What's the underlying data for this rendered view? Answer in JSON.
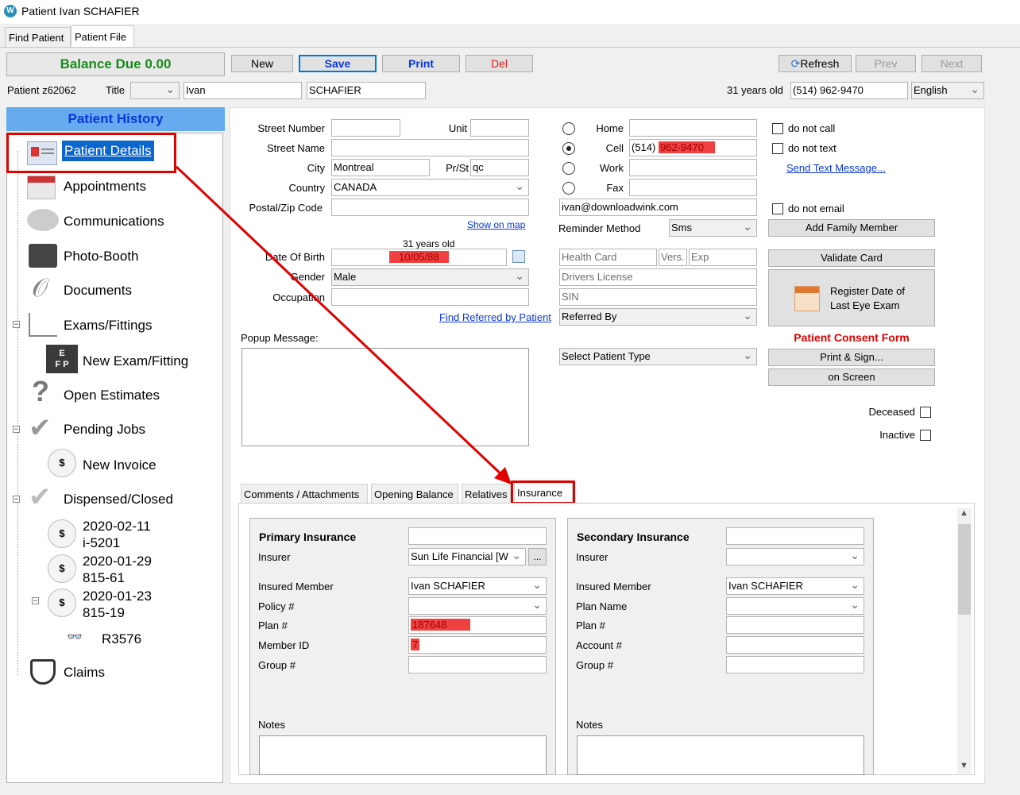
{
  "window": {
    "title": "Patient Ivan SCHAFIER"
  },
  "tabs": [
    "Find Patient",
    "Patient File"
  ],
  "toolbar": {
    "balance": "Balance Due 0.00",
    "new": "New",
    "save": "Save",
    "print": "Print",
    "del": "Del",
    "refresh": "Refresh",
    "prev": "Prev",
    "next": "Next"
  },
  "patient": {
    "id": "Patient z62062",
    "title_label": "Title",
    "title_value": "",
    "first_name": "Ivan",
    "last_name": "SCHAFIER",
    "age": "31 years old",
    "phone": "(514) 962-9470",
    "language": "English"
  },
  "history": {
    "header": "Patient History",
    "items": {
      "details": "Patient Details",
      "appointments": "Appointments",
      "communications": "Communications",
      "photo": "Photo-Booth",
      "documents": "Documents",
      "exams": "Exams/Fittings",
      "new_exam": "New Exam/Fitting",
      "estimates": "Open Estimates",
      "pending": "Pending Jobs",
      "new_invoice": "New Invoice",
      "dispensed": "Dispensed/Closed",
      "d1a": "2020-02-11",
      "d1b": "i-5201",
      "d2a": "2020-01-29",
      "d2b": "815-61",
      "d3a": "2020-01-23",
      "d3b": "815-19",
      "r3576": "R3576",
      "claims": "Claims"
    }
  },
  "address": {
    "street_number_label": "Street Number",
    "unit_label": "Unit",
    "street_name_label": "Street Name",
    "city_label": "City",
    "city": "Montreal",
    "prst_label": "Pr/St",
    "prst": "qc",
    "country_label": "Country",
    "country": "CANADA",
    "postal_label": "Postal/Zip Code",
    "show_map": "Show on map"
  },
  "dob": {
    "age_hint": "31 years old",
    "label": "Date Of Birth",
    "value": "10/05/88",
    "gender_label": "Gender",
    "gender": "Male",
    "occupation_label": "Occupation",
    "find_referred": "Find Referred by Patient"
  },
  "popup_label": "Popup Message:",
  "contact": {
    "home": "Home",
    "cell": "Cell",
    "cell_prefix": "(514)",
    "cell_number": "962-9470",
    "work": "Work",
    "fax": "Fax",
    "email": "ivan@downloadwink.com",
    "reminder_label": "Reminder Method",
    "reminder": "Sms",
    "health_card": "Health Card",
    "vers": "Vers.",
    "exp": "Exp",
    "drivers": "Drivers License",
    "sin": "SIN",
    "referred_by": "Referred By",
    "patient_type": "Select Patient Type"
  },
  "right": {
    "do_not_call": "do not call",
    "do_not_text": "do not text",
    "send_text": "Send Text Message...",
    "do_not_email": "do not email",
    "add_family": "Add Family Member",
    "validate": "Validate Card",
    "register_line1": "Register Date of",
    "register_line2": "Last Eye Exam",
    "consent": "Patient Consent Form",
    "print_sign": "Print & Sign...",
    "on_screen": "on Screen",
    "deceased": "Deceased",
    "inactive": "Inactive"
  },
  "subtabs": [
    "Comments / Attachments",
    "Opening Balance",
    "Relatives",
    "Insurance"
  ],
  "primary": {
    "title": "Primary Insurance",
    "insurer_label": "Insurer",
    "insurer": "Sun Life Financial [W",
    "insured_label": "Insured Member",
    "insured": "Ivan SCHAFIER",
    "policy_label": "Policy #",
    "plan_label": "Plan #",
    "plan": "187648",
    "member_label": "Member ID",
    "member": "7",
    "group_label": "Group #",
    "notes_label": "Notes",
    "more": "..."
  },
  "secondary": {
    "title": "Secondary Insurance",
    "insurer_label": "Insurer",
    "insured_label": "Insured Member",
    "insured": "Ivan SCHAFIER",
    "plan_name_label": "Plan Name",
    "plan_label": "Plan #",
    "account_label": "Account #",
    "group_label": "Group #",
    "notes_label": "Notes"
  },
  "colors": {
    "balance": "#1a8a1a",
    "accent_blue": "#0a37d6",
    "header_bg": "#66aaf0",
    "red": "#e00000"
  }
}
